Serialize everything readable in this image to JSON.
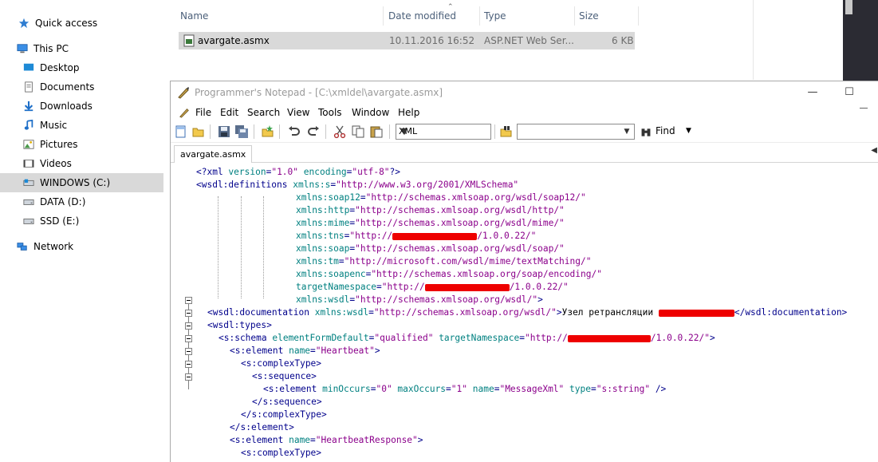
{
  "explorer": {
    "nav": [
      {
        "label": "Quick access",
        "icon": "star-icon"
      },
      {
        "label": "This PC",
        "icon": "computer-icon"
      },
      {
        "label": "Desktop",
        "icon": "desktop-icon"
      },
      {
        "label": "Documents",
        "icon": "documents-icon"
      },
      {
        "label": "Downloads",
        "icon": "downloads-icon"
      },
      {
        "label": "Music",
        "icon": "music-icon"
      },
      {
        "label": "Pictures",
        "icon": "pictures-icon"
      },
      {
        "label": "Videos",
        "icon": "videos-icon"
      },
      {
        "label": "WINDOWS (C:)",
        "icon": "drive-icon",
        "selected": true
      },
      {
        "label": "DATA (D:)",
        "icon": "drive-icon"
      },
      {
        "label": "SSD (E:)",
        "icon": "drive-icon"
      },
      {
        "label": "Network",
        "icon": "network-icon"
      }
    ],
    "columns": {
      "name": "Name",
      "date": "Date modified",
      "type": "Type",
      "size": "Size"
    },
    "file": {
      "name": "avargate.asmx",
      "date": "10.11.2016 16:52",
      "type": "ASP.NET Web Ser...",
      "size": "6 KB"
    }
  },
  "notepad": {
    "title": "Programmer's Notepad - [C:\\xmldel\\avargate.asmx]",
    "menu": [
      "File",
      "Edit",
      "Search",
      "View",
      "Tools",
      "Window",
      "Help"
    ],
    "language": "XML",
    "find_value": "",
    "find_label": "Find",
    "tab": "avargate.asmx",
    "code": {
      "l1": {
        "a": "<?xml ",
        "b": "version",
        "c": "=",
        "d": "\"1.0\"",
        "e": " encoding",
        "f": "=",
        "g": "\"utf-8\"",
        "h": "?>"
      },
      "l2": {
        "a": "<wsdl:definitions ",
        "b": "xmlns:s",
        "c": "=",
        "d": "\"http://www.w3.org/2001/XMLSchema\""
      },
      "l3": {
        "b": "xmlns:soap12",
        "c": "=",
        "d": "\"http://schemas.xmlsoap.org/wsdl/soap12/\""
      },
      "l4": {
        "b": "xmlns:http",
        "c": "=",
        "d": "\"http://schemas.xmlsoap.org/wsdl/http/\""
      },
      "l5": {
        "b": "xmlns:mime",
        "c": "=",
        "d": "\"http://schemas.xmlsoap.org/wsdl/mime/\""
      },
      "l6": {
        "b": "xmlns:tns",
        "c": "=",
        "d": "\"http://",
        "e": "/1.0.0.22/\""
      },
      "l7": {
        "b": "xmlns:soap",
        "c": "=",
        "d": "\"http://schemas.xmlsoap.org/wsdl/soap/\""
      },
      "l8": {
        "b": "xmlns:tm",
        "c": "=",
        "d": "\"http://microsoft.com/wsdl/mime/textMatching/\""
      },
      "l9": {
        "b": "xmlns:soapenc",
        "c": "=",
        "d": "\"http://schemas.xmlsoap.org/soap/encoding/\""
      },
      "l10": {
        "b": "targetNamespace",
        "c": "=",
        "d": "\"http://",
        "e": "/1.0.0.22/\""
      },
      "l11": {
        "b": "xmlns:wsdl",
        "c": "=",
        "d": "\"http://schemas.xmlsoap.org/wsdl/\"",
        "e": ">"
      },
      "l12": {
        "a": "<wsdl:documentation ",
        "b": "xmlns:wsdl",
        "c": "=",
        "d": "\"http://schemas.xmlsoap.org/wsdl/\"",
        "e": ">",
        "f": "Узел ретрансляции ",
        "g": "</wsdl:documentation>"
      },
      "l13": {
        "a": "<wsdl:types>"
      },
      "l14": {
        "a": "<s:schema ",
        "b": "elementFormDefault",
        "c": "=",
        "d": "\"qualified\"",
        "e": " targetNamespace",
        "f": "=",
        "g": "\"http://",
        "h": "/1.0.0.22/\"",
        "i": ">"
      },
      "l15": {
        "a": "<s:element ",
        "b": "name",
        "c": "=",
        "d": "\"Heartbeat\"",
        "e": ">"
      },
      "l16": {
        "a": "<s:complexType>"
      },
      "l17": {
        "a": "<s:sequence>"
      },
      "l18": {
        "a": "<s:element ",
        "b": "minOccurs",
        "c": "=",
        "d": "\"0\"",
        "e": " maxOccurs",
        "f": "=",
        "g": "\"1\"",
        "h": " name",
        "i": "=",
        "j": "\"MessageXml\"",
        "k": " type",
        "l": "=",
        "m": "\"s:string\"",
        "n": " />"
      },
      "l19": {
        "a": "</s:sequence>"
      },
      "l20": {
        "a": "</s:complexType>"
      },
      "l21": {
        "a": "</s:element>"
      },
      "l22": {
        "a": "<s:element ",
        "b": "name",
        "c": "=",
        "d": "\"HeartbeatResponse\"",
        "e": ">"
      },
      "l23": {
        "a": "<s:complexType>"
      }
    }
  },
  "colors": {
    "accent_blue": "#0078d7",
    "tag": "#00008b",
    "attr": "#008080",
    "value": "#8b008b",
    "redaction": "#ee0000"
  }
}
